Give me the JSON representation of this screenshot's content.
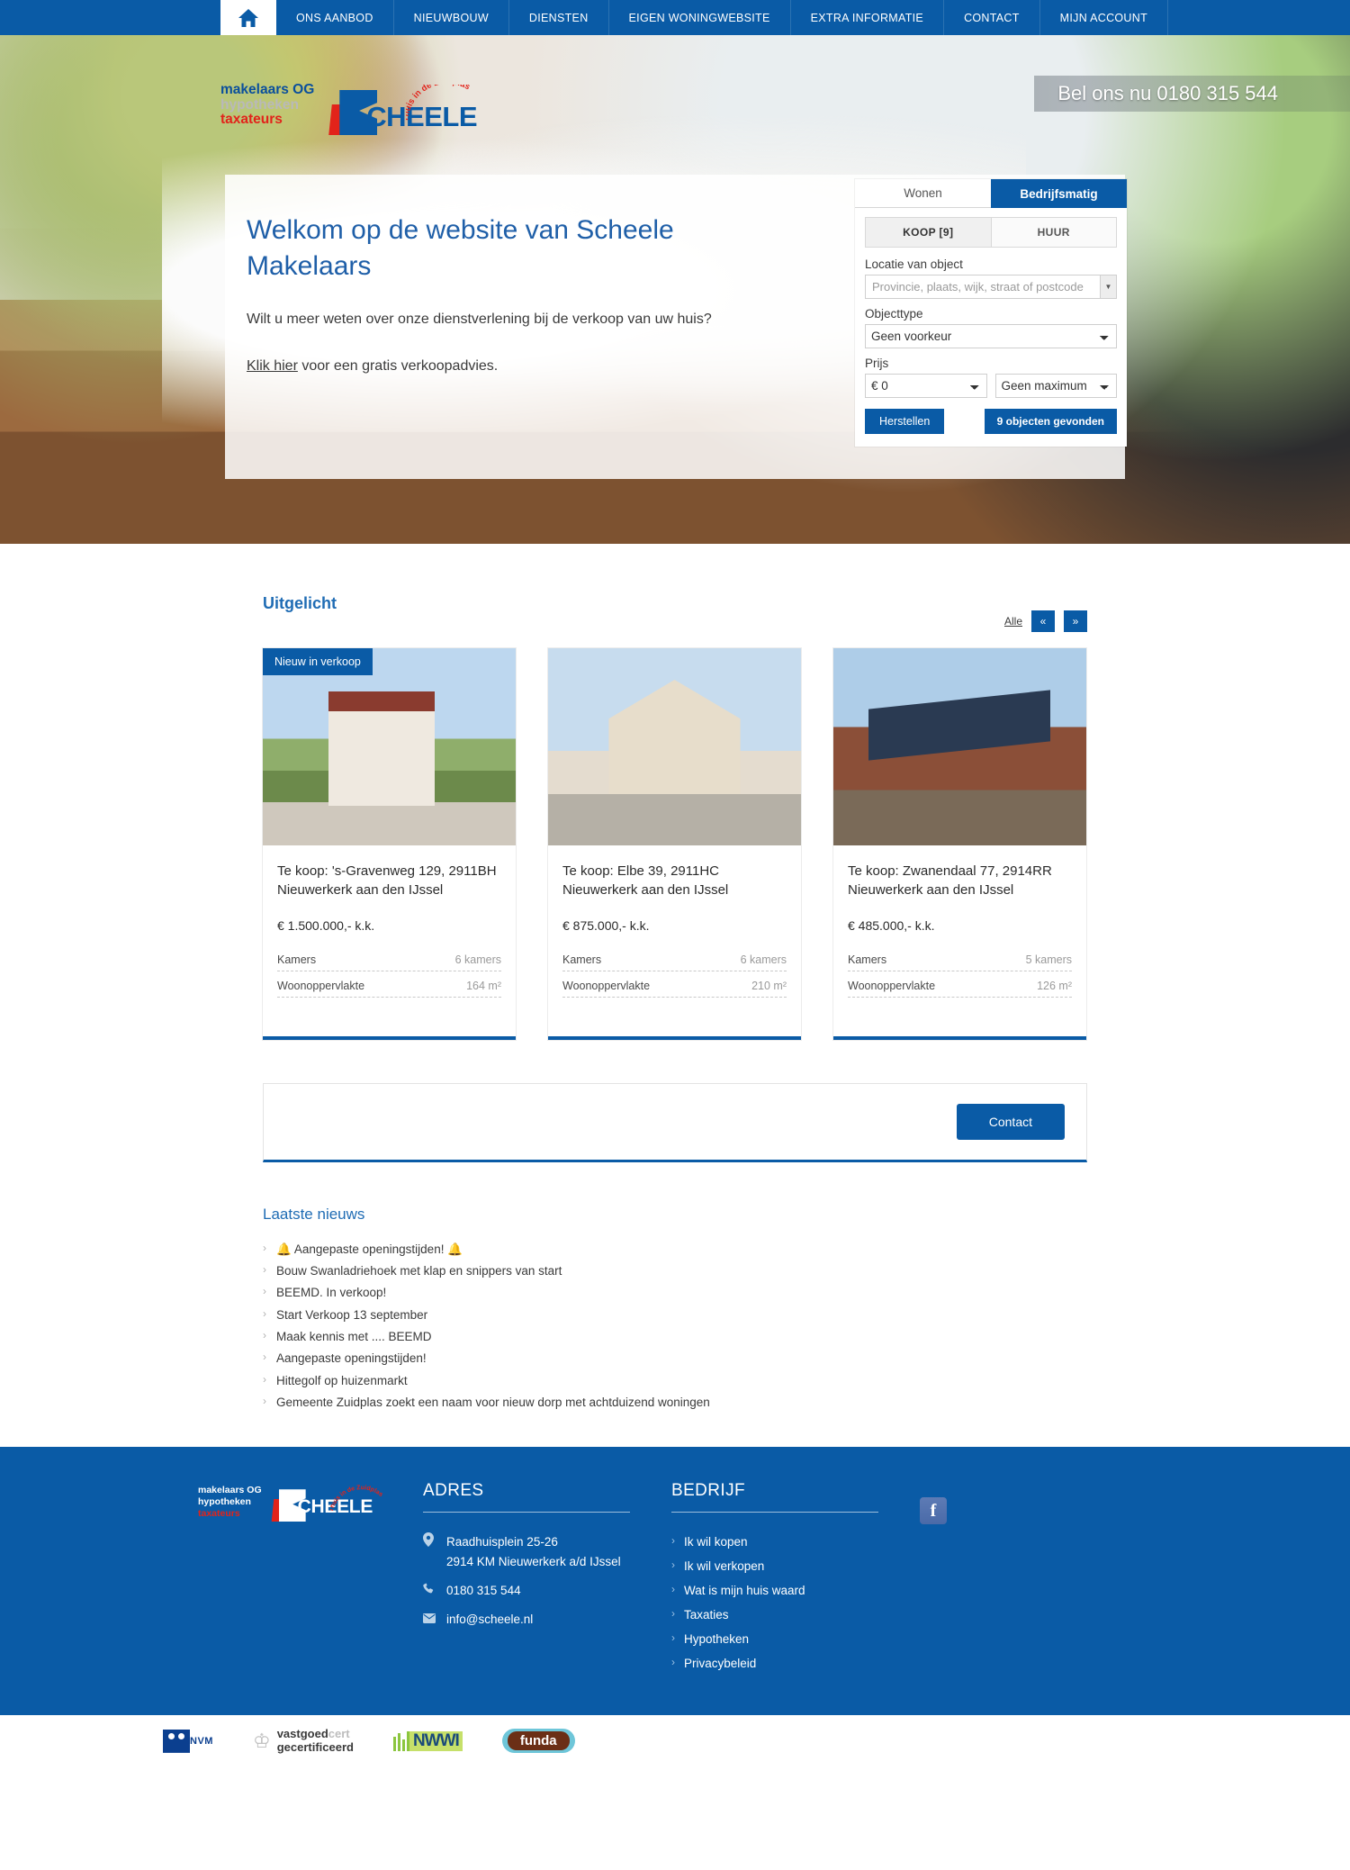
{
  "nav": {
    "home_icon": "home-icon",
    "items": [
      {
        "label": "ONS AANBOD"
      },
      {
        "label": "NIEUWBOUW"
      },
      {
        "label": "DIENSTEN"
      },
      {
        "label": "EIGEN WONINGWEBSITE"
      },
      {
        "label": "EXTRA INFORMATIE"
      },
      {
        "label": "CONTACT"
      },
      {
        "label": "MIJN ACCOUNT"
      }
    ]
  },
  "brand": {
    "line1": "makelaars OG",
    "line2": "hypotheken",
    "line3": "taxateurs",
    "logo_text": "CHEELE",
    "logo_arc": "Thuis in de Zuidplas"
  },
  "phone_bar": {
    "text": "Bel ons nu 0180 315 544"
  },
  "hero": {
    "title": "Welkom op de website van Scheele Makelaars",
    "paragraph": "Wilt u meer weten over onze dienstverlening bij de verkoop van uw huis?",
    "link_text": "Klik hier",
    "link_suffix": " voor een gratis verkoopadvies."
  },
  "search": {
    "tabs": [
      {
        "label": "Wonen",
        "active": false
      },
      {
        "label": "Bedrijfsmatig",
        "active": true
      }
    ],
    "subtabs": [
      {
        "label": "KOOP [9]",
        "active": true
      },
      {
        "label": "HUUR",
        "active": false
      }
    ],
    "location_label": "Locatie van object",
    "location_placeholder": "Provincie, plaats, wijk, straat of postcode",
    "location_value": "",
    "objecttype_label": "Objecttype",
    "objecttype_value": "Geen voorkeur",
    "objecttype_options": [
      "Geen voorkeur"
    ],
    "price_label": "Prijs",
    "price_min_value": "€ 0",
    "price_min_options": [
      "€ 0"
    ],
    "price_max_value": "Geen maximum",
    "price_max_options": [
      "Geen maximum"
    ],
    "reset_label": "Herstellen",
    "results_label": "9 objecten gevonden"
  },
  "featured": {
    "title": "Uitgelicht",
    "all_label": "Alle",
    "prev_icon": "«",
    "next_icon": "»",
    "cards": [
      {
        "badge": "Nieuw in verkoop",
        "title": "Te koop: 's-Gravenweg 129, 2911BH Nieuwerkerk aan den IJssel",
        "price": "€ 1.500.000,- k.k.",
        "specs": [
          {
            "key": "Kamers",
            "value": "6 kamers"
          },
          {
            "key": "Woonoppervlakte",
            "value": "164 m²"
          }
        ]
      },
      {
        "badge": "",
        "title": "Te koop: Elbe 39, 2911HC Nieuwerkerk aan den IJssel",
        "price": "€ 875.000,- k.k.",
        "specs": [
          {
            "key": "Kamers",
            "value": "6 kamers"
          },
          {
            "key": "Woonoppervlakte",
            "value": "210 m²"
          }
        ]
      },
      {
        "badge": "",
        "title": "Te koop: Zwanendaal 77, 2914RR Nieuwerkerk aan den IJssel",
        "price": "€ 485.000,- k.k.",
        "specs": [
          {
            "key": "Kamers",
            "value": "5 kamers"
          },
          {
            "key": "Woonoppervlakte",
            "value": "126 m²"
          }
        ]
      }
    ]
  },
  "contact_cta": {
    "button_label": "Contact"
  },
  "news": {
    "title": "Laatste nieuws",
    "items": [
      {
        "label": "🔔 Aangepaste openingstijden! 🔔"
      },
      {
        "label": "Bouw Swanladriehoek met klap en snippers van start"
      },
      {
        "label": "BEEMD. In verkoop!"
      },
      {
        "label": "Start Verkoop 13 september"
      },
      {
        "label": "Maak kennis met .... BEEMD"
      },
      {
        "label": "Aangepaste openingstijden!"
      },
      {
        "label": "Hittegolf op huizenmarkt"
      },
      {
        "label": "Gemeente Zuidplas zoekt een naam voor nieuw dorp met achtduizend woningen"
      }
    ]
  },
  "footer": {
    "address": {
      "heading": "ADRES",
      "street": "Raadhuisplein 25-26",
      "city": "2914 KM Nieuwerkerk a/d IJssel",
      "phone": "0180 315 544",
      "email": "info@scheele.nl"
    },
    "company": {
      "heading": "BEDRIJF",
      "links": [
        {
          "label": "Ik wil kopen"
        },
        {
          "label": "Ik wil verkopen"
        },
        {
          "label": "Wat is mijn huis waard"
        },
        {
          "label": "Taxaties"
        },
        {
          "label": "Hypotheken"
        },
        {
          "label": "Privacybeleid"
        }
      ]
    },
    "social": {
      "facebook_label": "f"
    }
  },
  "certifications": [
    {
      "name": "NVM",
      "label": "NVM"
    },
    {
      "name": "vastgoedcert",
      "label1a": "vastgoed",
      "label1b": "cert",
      "label2": "gecertificeerd"
    },
    {
      "name": "NWWI",
      "label": "NWWI"
    },
    {
      "name": "funda",
      "label": "funda"
    }
  ],
  "colors": {
    "brand_blue": "#0a5ba6",
    "link_blue": "#1f6cb4",
    "accent_red": "#e2231a"
  }
}
